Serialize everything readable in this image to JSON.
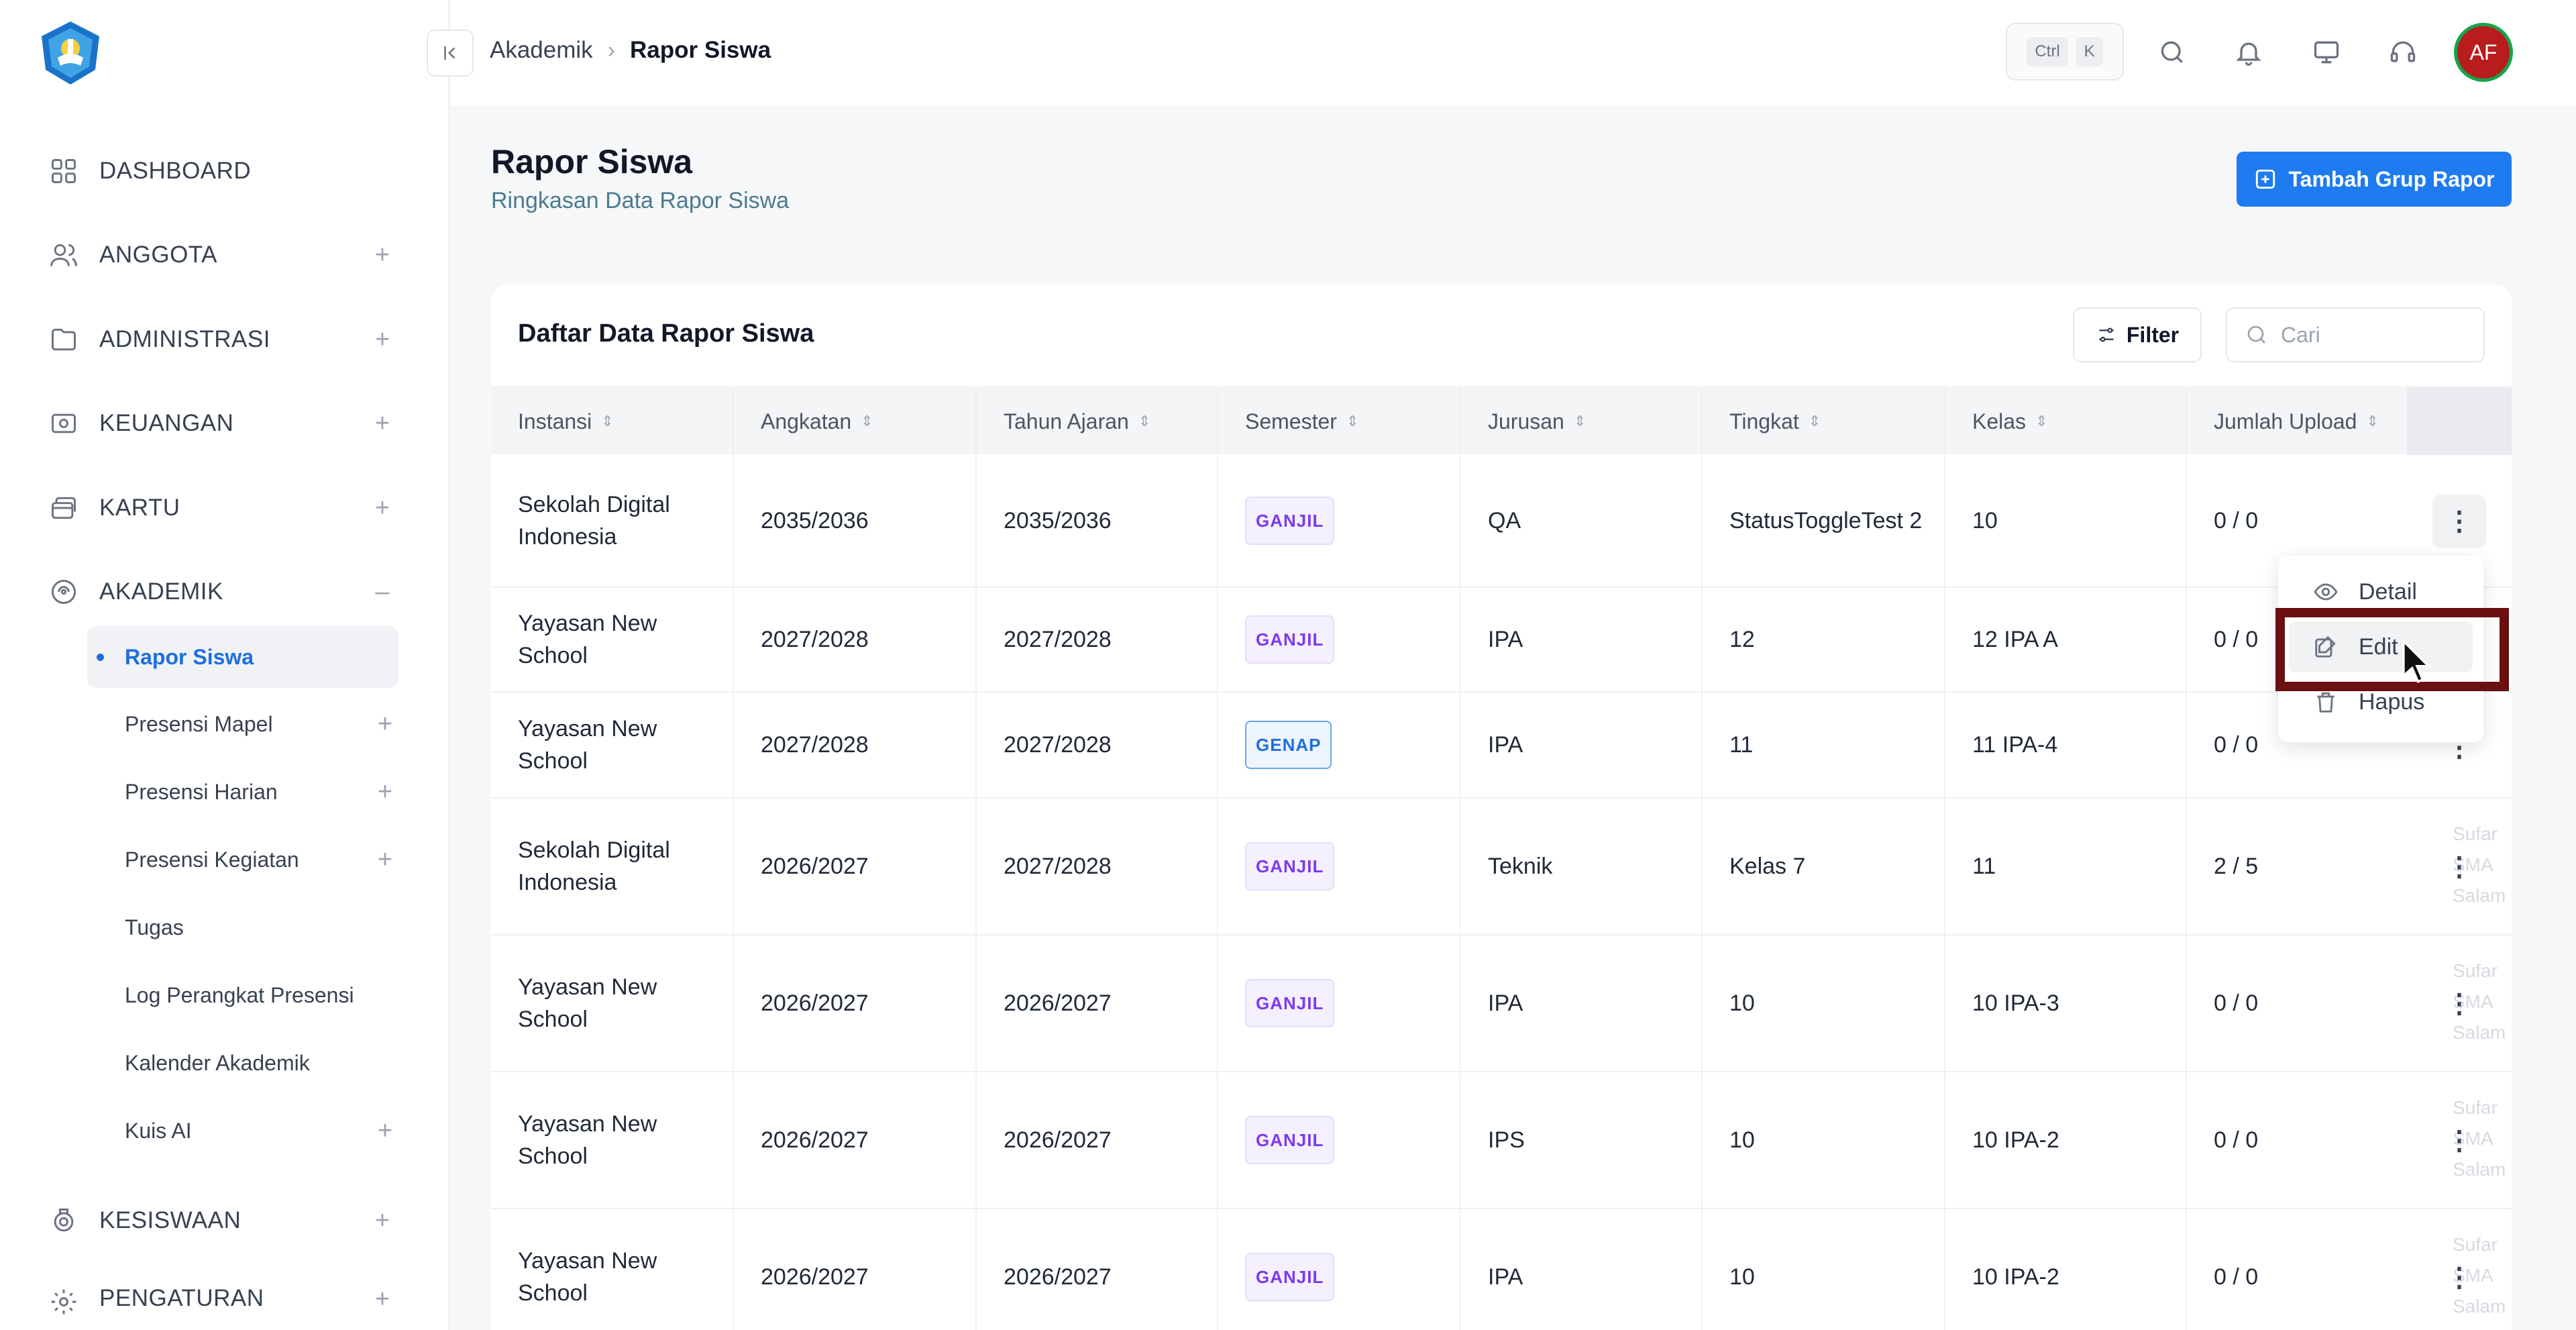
{
  "sidebar": {
    "logo": "tut-wuri-handayani-logo",
    "items": [
      {
        "label": "DASHBOARD",
        "icon": "grid-icon",
        "expandable": false
      },
      {
        "label": "ANGGOTA",
        "icon": "users-icon",
        "expandable": true,
        "toggle": "+"
      },
      {
        "label": "ADMINISTRASI",
        "icon": "folder-icon",
        "expandable": true,
        "toggle": "+"
      },
      {
        "label": "KEUANGAN",
        "icon": "money-icon",
        "expandable": true,
        "toggle": "+"
      },
      {
        "label": "KARTU",
        "icon": "cards-icon",
        "expandable": true,
        "toggle": "+"
      },
      {
        "label": "AKADEMIK",
        "icon": "academic-icon",
        "expandable": true,
        "toggle": "–"
      },
      {
        "label": "KESISWAAN",
        "icon": "student-icon",
        "expandable": true,
        "toggle": "+"
      },
      {
        "label": "PENGATURAN",
        "icon": "settings-icon",
        "expandable": true,
        "toggle": "+"
      }
    ],
    "subitems": [
      {
        "label": "Rapor Siswa",
        "active": true,
        "toggle": ""
      },
      {
        "label": "Presensi Mapel",
        "toggle": "+"
      },
      {
        "label": "Presensi Harian",
        "toggle": "+"
      },
      {
        "label": "Presensi Kegiatan",
        "toggle": "+"
      },
      {
        "label": "Tugas",
        "toggle": ""
      },
      {
        "label": "Log Perangkat Presensi",
        "toggle": ""
      },
      {
        "label": "Kalender Akademik",
        "toggle": ""
      },
      {
        "label": "Kuis AI",
        "toggle": "+"
      }
    ]
  },
  "topbar": {
    "breadcrumb": [
      "Akademik",
      "Rapor Siswa"
    ],
    "shortcut": [
      "Ctrl",
      "K"
    ],
    "avatar_initials": "AF"
  },
  "page": {
    "title": "Rapor Siswa",
    "subtitle": "Ringkasan Data Rapor Siswa",
    "primary_button": "Tambah Grup Rapor"
  },
  "card": {
    "title": "Daftar Data Rapor Siswa",
    "filter_label": "Filter",
    "search_placeholder": "Cari"
  },
  "table": {
    "columns": [
      "Instansi",
      "Angkatan",
      "Tahun Ajaran",
      "Semester",
      "Jurusan",
      "Tingkat",
      "Kelas",
      "Jumlah Upload"
    ],
    "rows": [
      {
        "instansi": "Sekolah Digital Indonesia",
        "angkatan": "2035/2036",
        "tahun": "2035/2036",
        "semester": "GANJIL",
        "jurusan": "QA",
        "tingkat": "StatusToggleTest 2",
        "kelas": "10",
        "upload": "0 / 0",
        "ghost": ""
      },
      {
        "instansi": "Yayasan New School",
        "angkatan": "2027/2028",
        "tahun": "2027/2028",
        "semester": "GANJIL",
        "jurusan": "IPA",
        "tingkat": "12",
        "kelas": "12 IPA A",
        "upload": "0 / 0",
        "ghost": ""
      },
      {
        "instansi": "Yayasan New School",
        "angkatan": "2027/2028",
        "tahun": "2027/2028",
        "semester": "GENAP",
        "jurusan": "IPA",
        "tingkat": "11",
        "kelas": "11 IPA-4",
        "upload": "0 / 0",
        "ghost": ""
      },
      {
        "instansi": "Sekolah Digital Indonesia",
        "angkatan": "2026/2027",
        "tahun": "2027/2028",
        "semester": "GANJIL",
        "jurusan": "Teknik",
        "tingkat": "Kelas 7",
        "kelas": "11",
        "upload": "2 / 5",
        "ghost": "Sufar\nSMA\nSalam"
      },
      {
        "instansi": "Yayasan New School",
        "angkatan": "2026/2027",
        "tahun": "2026/2027",
        "semester": "GANJIL",
        "jurusan": "IPA",
        "tingkat": "10",
        "kelas": "10 IPA-3",
        "upload": "0 / 0",
        "ghost": "Sufar\nSMA\nSalam"
      },
      {
        "instansi": "Yayasan New School",
        "angkatan": "2026/2027",
        "tahun": "2026/2027",
        "semester": "GANJIL",
        "jurusan": "IPS",
        "tingkat": "10",
        "kelas": "10 IPA-2",
        "upload": "0 / 0",
        "ghost": "Sufar\nSMA\nSalam"
      },
      {
        "instansi": "Yayasan New School",
        "angkatan": "2026/2027",
        "tahun": "2026/2027",
        "semester": "GANJIL",
        "jurusan": "IPA",
        "tingkat": "10",
        "kelas": "10 IPA-2",
        "upload": "0 / 0",
        "ghost": "Sufar\nSMA\nSalam"
      }
    ]
  },
  "row_menu": {
    "items": [
      {
        "label": "Detail",
        "icon": "eye-icon"
      },
      {
        "label": "Edit",
        "icon": "edit-icon"
      },
      {
        "label": "Hapus",
        "icon": "trash-icon"
      }
    ]
  },
  "colors": {
    "accent": "#1e7bf0",
    "active_nav": "#1d6fe0",
    "ganjil": "#7c3aed",
    "highlight_box": "#6b0f12"
  }
}
